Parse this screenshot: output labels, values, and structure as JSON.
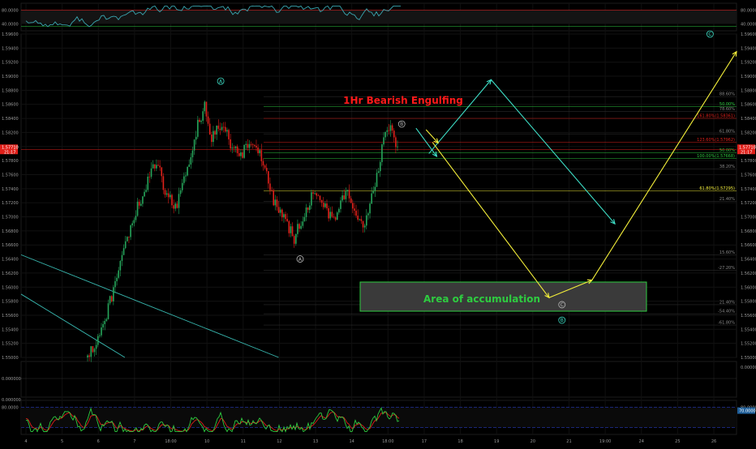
{
  "chart_data": {
    "type": "candlestick",
    "colors": {
      "background": "#000000",
      "grid": "#1a1a1a",
      "up": "#26a65b",
      "down": "#e0201a",
      "cyan": "#3ee0c8",
      "yellow": "#f5f03a",
      "red_label": "#ff1a1a",
      "zone_fill": "#3a3a3a",
      "zone_border": "#2ecc40",
      "zone_text": "#2ecc40",
      "fib_line": "#2a2a2a",
      "fib_text": "#8a8a8a",
      "rsi_line": "#3aa6b0",
      "stoch_k": "#2ecc40",
      "stoch_d": "#e0201a",
      "stoch_band": "#1f2f9a"
    },
    "price_axis": {
      "ylim": [
        1.55,
        1.596
      ],
      "ticks": [
        "1.59600",
        "1.59400",
        "1.59200",
        "1.59000",
        "1.58800",
        "1.58600",
        "1.58400",
        "1.58200",
        "1.58000",
        "1.57800",
        "1.57600",
        "1.57400",
        "1.57200",
        "1.57000",
        "1.56800",
        "1.56600",
        "1.56400",
        "1.56200",
        "1.56000",
        "1.55800",
        "1.55600",
        "1.55400",
        "1.55200",
        "1.55000"
      ],
      "tick_values": [
        1.596,
        1.594,
        1.592,
        1.59,
        1.588,
        1.586,
        1.584,
        1.582,
        1.58,
        1.578,
        1.576,
        1.574,
        1.572,
        1.57,
        1.568,
        1.566,
        1.564,
        1.562,
        1.56,
        1.558,
        1.556,
        1.554,
        1.552,
        1.55
      ],
      "current_price": {
        "label": "1.57710",
        "sub": "21:17",
        "value": 1.5796
      }
    },
    "time_axis": {
      "labels": [
        "4",
        "5",
        "6",
        "7",
        "18:00",
        "10",
        "11",
        "12",
        "13",
        "14",
        "18:00",
        "17",
        "18",
        "19",
        "20",
        "21",
        "19:00",
        "24",
        "25",
        "26"
      ]
    },
    "candles_seed": 20150618,
    "candles_anchor_path": [
      [
        0,
        1.55
      ],
      [
        6,
        1.5525
      ],
      [
        12,
        1.557
      ],
      [
        18,
        1.562
      ],
      [
        24,
        1.568
      ],
      [
        30,
        1.572
      ],
      [
        36,
        1.576
      ],
      [
        40,
        1.578
      ],
      [
        46,
        1.573
      ],
      [
        52,
        1.5715
      ],
      [
        58,
        1.577
      ],
      [
        64,
        1.583
      ],
      [
        68,
        1.5855
      ],
      [
        72,
        1.581
      ],
      [
        78,
        1.5835
      ],
      [
        84,
        1.58
      ],
      [
        90,
        1.579
      ],
      [
        96,
        1.581
      ],
      [
        102,
        1.578
      ],
      [
        108,
        1.5725
      ],
      [
        114,
        1.57
      ],
      [
        120,
        1.567
      ],
      [
        126,
        1.5705
      ],
      [
        132,
        1.574
      ],
      [
        138,
        1.571
      ],
      [
        144,
        1.569
      ],
      [
        150,
        1.574
      ],
      [
        156,
        1.5705
      ],
      [
        160,
        1.568
      ],
      [
        164,
        1.572
      ],
      [
        168,
        1.576
      ],
      [
        172,
        1.581
      ],
      [
        176,
        1.583
      ],
      [
        180,
        1.58
      ]
    ],
    "fib_levels": [
      {
        "label": "88.60%",
        "value": 1.5871,
        "color": "#8a8a8a"
      },
      {
        "label": "50.00%",
        "value": 1.5857,
        "color": "#2ecc40"
      },
      {
        "label": "78.60%",
        "value": 1.585,
        "color": "#8a8a8a"
      },
      {
        "label": "161.80%(1.58361)",
        "value": 1.584,
        "color": "#e0201a"
      },
      {
        "label": "61.80%",
        "value": 1.5818,
        "color": "#8a8a8a"
      },
      {
        "label": "123.60%(1.57962)",
        "value": 1.5806,
        "color": "#e0201a"
      },
      {
        "label": "50.00%",
        "value": 1.5791,
        "color": "#2ecc40"
      },
      {
        "label": "100.00%(1.57668)",
        "value": 1.5783,
        "color": "#2ecc40"
      },
      {
        "label": "38.20%",
        "value": 1.5768,
        "color": "#8a8a8a"
      },
      {
        "label": "61.80%(1.57295)",
        "value": 1.5737,
        "color": "#f5f03a"
      },
      {
        "label": "21.40%",
        "value": 1.5722,
        "color": "#8a8a8a"
      },
      {
        "label": "15.60%",
        "value": 1.5646,
        "color": "#8a8a8a"
      },
      {
        "label": "-27.20%",
        "value": 1.5624,
        "color": "#8a8a8a"
      },
      {
        "label": "21.40%",
        "value": 1.5575,
        "color": "#8a8a8a"
      },
      {
        "label": "-54.40%",
        "value": 1.5562,
        "color": "#8a8a8a"
      },
      {
        "label": "-61.80%",
        "value": 1.5546,
        "color": "#8a8a8a"
      }
    ],
    "annotations": {
      "title": "1Hr Bearish Engulfing",
      "zone_label": "Area of accumulation",
      "zone": {
        "x0": 0.49,
        "x1": 0.88,
        "y0": 1.5584,
        "y1": 1.5623
      },
      "wave_labels": [
        {
          "text": "A",
          "x": 0.279,
          "y": 1.5893,
          "circled": true,
          "color": "#3ee0c8"
        },
        {
          "text": "A",
          "x": 0.39,
          "y": 1.564,
          "circled": true,
          "color": "#bbbbbb"
        },
        {
          "text": "B",
          "x": 0.532,
          "y": 1.5832,
          "circled": true,
          "color": "#bbbbbb"
        },
        {
          "text": "C",
          "x": 0.756,
          "y": 1.5575,
          "circled": true,
          "color": "#bbbbbb"
        },
        {
          "text": "B",
          "x": 0.756,
          "y": 1.5553,
          "circled": true,
          "color": "#3ee0c8"
        },
        {
          "text": "C",
          "x": 0.963,
          "y": 1.596,
          "circled": true,
          "color": "#3ee0c8"
        }
      ],
      "cyan_path": [
        [
          0.57,
          1.579
        ],
        [
          0.657,
          1.5895
        ],
        [
          0.83,
          1.569
        ]
      ],
      "cyan_tick": [
        [
          0.552,
          1.5826
        ],
        [
          0.581,
          1.5786
        ]
      ],
      "yellow_path": [
        [
          0.575,
          1.5806
        ],
        [
          0.738,
          1.5585
        ],
        [
          0.798,
          1.561
        ],
        [
          1.0,
          1.5935
        ]
      ],
      "yellow_tick": [
        [
          0.566,
          1.5824
        ],
        [
          0.583,
          1.5805
        ]
      ],
      "trendlines": [
        [
          [
            0.0,
            1.5646
          ],
          [
            0.36,
            1.55
          ]
        ],
        [
          [
            0.0,
            1.559
          ],
          [
            0.145,
            1.55
          ]
        ]
      ]
    },
    "rsi": {
      "ticks": [
        "80.0000",
        "40.0000"
      ],
      "tick_values": [
        80,
        40
      ],
      "ylim": [
        20,
        100
      ],
      "seed": 77
    },
    "mid_pane": {
      "ticks": [
        "0.000000",
        "0.000000"
      ]
    },
    "stoch": {
      "ticks": [
        "80.0000",
        "0.0000"
      ],
      "current": "70.0000",
      "ylim": [
        0,
        100
      ],
      "seed": 91
    }
  }
}
